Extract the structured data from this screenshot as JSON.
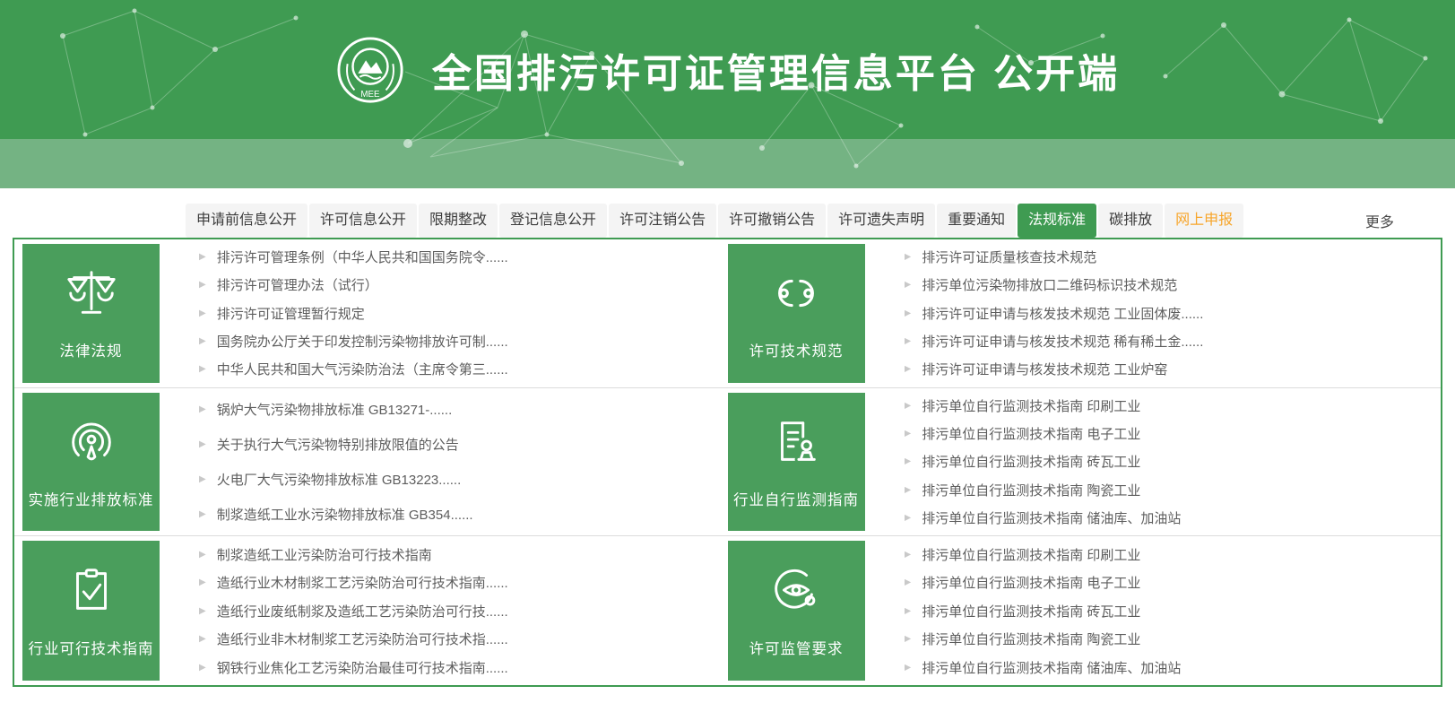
{
  "header": {
    "title": "全国排污许可证管理信息平台  公开端",
    "logo_text": "MEE"
  },
  "more_label": "更多",
  "colors": {
    "brand_green": "#3f9b52",
    "box_green": "#4a9e5c",
    "band_green": "#74b383",
    "tab_bg": "#f4f4f4",
    "highlight_orange": "#f7a52a",
    "link_text": "#5d5d5d",
    "divider": "#dcdcdc"
  },
  "tabs": [
    {
      "name": "tab-pre-application-disclosure",
      "label": "申请前信息公开",
      "state": ""
    },
    {
      "name": "tab-permit-info-disclosure",
      "label": "许可信息公开",
      "state": ""
    },
    {
      "name": "tab-deadline-rectification",
      "label": "限期整改",
      "state": ""
    },
    {
      "name": "tab-registration-info-disclosure",
      "label": "登记信息公开",
      "state": ""
    },
    {
      "name": "tab-permit-cancellation-notice",
      "label": "许可注销公告",
      "state": ""
    },
    {
      "name": "tab-permit-revocation-notice",
      "label": "许可撤销公告",
      "state": ""
    },
    {
      "name": "tab-permit-loss-statement",
      "label": "许可遗失声明",
      "state": ""
    },
    {
      "name": "tab-important-notice",
      "label": "重要通知",
      "state": ""
    },
    {
      "name": "tab-regulations-standards",
      "label": "法规标准",
      "state": "active"
    },
    {
      "name": "tab-carbon-emission",
      "label": "碳排放",
      "state": ""
    },
    {
      "name": "tab-online-declaration",
      "label": "网上申报",
      "state": "highlight"
    }
  ],
  "sections": [
    {
      "title": "法律法规",
      "icon": "scales-icon",
      "links": [
        "排污许可管理条例（中华人民共和国国务院令......",
        "排污许可管理办法（试行）",
        "排污许可证管理暂行规定",
        "国务院办公厅关于印发控制污染物排放许可制......",
        "中华人民共和国大气污染防治法（主席令第三......"
      ]
    },
    {
      "title": "许可技术规范",
      "icon": "chain-links-icon",
      "links": [
        "排污许可证质量核查技术规范",
        "排污单位污染物排放口二维码标识技术规范",
        "排污许可证申请与核发技术规范 工业固体废......",
        "排污许可证申请与核发技术规范 稀有稀土金......",
        "排污许可证申请与核发技术规范 工业炉窑"
      ]
    },
    {
      "title": "实施行业排放标准",
      "icon": "broadcast-icon",
      "links": [
        "锅炉大气污染物排放标准 GB13271-......",
        "关于执行大气污染物特别排放限值的公告",
        "火电厂大气污染物排放标准 GB13223......",
        "制浆造纸工业水污染物排放标准 GB354......"
      ]
    },
    {
      "title": "行业自行监测指南",
      "icon": "document-stamp-icon",
      "links": [
        "排污单位自行监测技术指南 印刷工业",
        "排污单位自行监测技术指南 电子工业",
        "排污单位自行监测技术指南 砖瓦工业",
        "排污单位自行监测技术指南 陶瓷工业",
        "排污单位自行监测技术指南 储油库、加油站"
      ]
    },
    {
      "title": "行业可行技术指南",
      "icon": "clipboard-check-icon",
      "links": [
        "制浆造纸工业污染防治可行技术指南",
        "造纸行业木材制浆工艺污染防治可行技术指南......",
        "造纸行业废纸制浆及造纸工艺污染防治可行技......",
        "造纸行业非木材制浆工艺污染防治可行技术指......",
        "钢铁行业焦化工艺污染防治最佳可行技术指南......"
      ]
    },
    {
      "title": "许可监管要求",
      "icon": "eye-monitor-icon",
      "links": [
        "排污单位自行监测技术指南 印刷工业",
        "排污单位自行监测技术指南 电子工业",
        "排污单位自行监测技术指南 砖瓦工业",
        "排污单位自行监测技术指南 陶瓷工业",
        "排污单位自行监测技术指南 储油库、加油站"
      ]
    }
  ]
}
